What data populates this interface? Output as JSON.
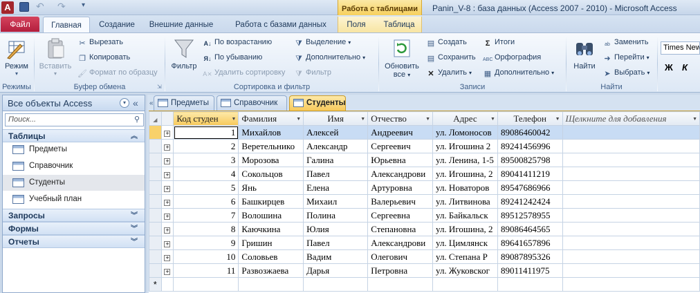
{
  "window": {
    "title": "Panin_V-8 : база данных (Access 2007 - 2010)  -  Microsoft Access",
    "app_letter": "A",
    "context_tab_header": "Работа с таблицами"
  },
  "ribbon_tabs": [
    "Главная",
    "Создание",
    "Внешние данные",
    "Работа с базами данных",
    "Поля",
    "Таблица"
  ],
  "file_tab": "Файл",
  "ribbon": {
    "modes": {
      "view_label": "Режим",
      "group_label": "Режимы"
    },
    "clipboard": {
      "paste": "Вставить",
      "cut": "Вырезать",
      "copy": "Копировать",
      "format_painter": "Формат по образцу",
      "group_label": "Буфер обмена"
    },
    "sort_filter": {
      "filter": "Фильтр",
      "ascending": "По возрастанию",
      "descending": "По убыванию",
      "remove_sort": "Удалить сортировку",
      "selection": "Выделение",
      "advanced": "Дополнительно",
      "toggle_filter": "Фильтр",
      "group_label": "Сортировка и фильтр"
    },
    "records": {
      "refresh_line1": "Обновить",
      "refresh_line2": "все",
      "new": "Создать",
      "save": "Сохранить",
      "delete": "Удалить",
      "totals": "Итоги",
      "spelling": "Орфография",
      "more": "Дополнительно",
      "group_label": "Записи"
    },
    "find": {
      "find": "Найти",
      "replace": "Заменить",
      "goto": "Перейти",
      "select": "Выбрать",
      "group_label": "Найти"
    },
    "text_format": {
      "font_name": "Times New",
      "bold": "Ж",
      "italic": "К"
    }
  },
  "nav_pane": {
    "header": "Все объекты Access",
    "search_placeholder": "Поиск...",
    "sections": {
      "tables": "Таблицы",
      "queries": "Запросы",
      "forms": "Формы",
      "reports": "Отчеты"
    },
    "tables": [
      "Предметы",
      "Справочник",
      "Студенты",
      "Учебный план"
    ]
  },
  "doc_tabs": [
    "Предметы",
    "Справочник",
    "Студенты"
  ],
  "grid": {
    "columns": [
      "Код студен",
      "Фамилия",
      "Имя",
      "Отчество",
      "Адрес",
      "Телефон",
      "Щелкните для добавления"
    ],
    "rows": [
      [
        "1",
        "Михайлов",
        "Алексей",
        "Андреевич",
        "ул. Ломоносов",
        "89086460042"
      ],
      [
        "2",
        "Веретельнико",
        "Александр",
        "Сергеевич",
        "ул. Игошина 2",
        "89241456996"
      ],
      [
        "3",
        "Морозова",
        "Галина",
        "Юрьевна",
        "ул. Ленина, 1-5",
        "89500825798"
      ],
      [
        "4",
        "Сокольцов",
        "Павел",
        "Александрови",
        "ул. Игошина, 2",
        "89041411219"
      ],
      [
        "5",
        "Янь",
        "Елена",
        "Артуровна",
        "ул. Новаторов",
        "89547686966"
      ],
      [
        "6",
        "Башкирцев",
        "Михаил",
        "Валерьевич",
        "ул. Литвинова",
        "89241242424"
      ],
      [
        "7",
        "Волошина",
        "Полина",
        "Сергеевна",
        "ул. Байкальск",
        "89512578955"
      ],
      [
        "8",
        "Каючкина",
        "Юлия",
        "Степановна",
        "ул. Игошина, 2",
        "89086464565"
      ],
      [
        "9",
        "Гришин",
        "Павел",
        "Александрови",
        "ул. Цимлянск",
        "89641657896"
      ],
      [
        "10",
        "Соловьев",
        "Вадим",
        "Олегович",
        "ул. Степана Р",
        "89087895326"
      ],
      [
        "11",
        "Развозжаева",
        "Дарья",
        "Петровна",
        "ул. Жуковског",
        "89011411975"
      ]
    ],
    "new_row_marker": "*"
  }
}
